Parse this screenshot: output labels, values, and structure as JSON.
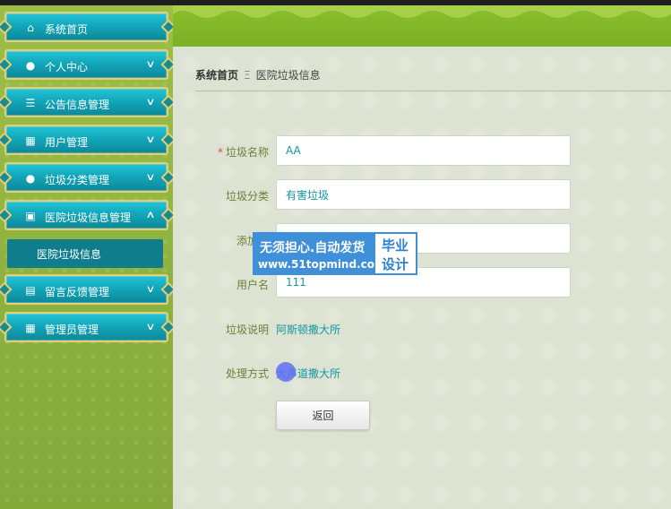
{
  "sidebar": {
    "items": [
      {
        "label": "系统首页",
        "icon": "home-icon",
        "glyph": "⌂",
        "chevron": ""
      },
      {
        "label": "个人中心",
        "icon": "user-icon",
        "glyph": "●",
        "chevron": "∨"
      },
      {
        "label": "公告信息管理",
        "icon": "list-icon",
        "glyph": "☰",
        "chevron": "∨"
      },
      {
        "label": "用户管理",
        "icon": "grid-icon",
        "glyph": "▦",
        "chevron": "∨"
      },
      {
        "label": "垃圾分类管理",
        "icon": "bulb-icon",
        "glyph": "●",
        "chevron": "∨"
      },
      {
        "label": "医院垃圾信息管理",
        "icon": "clipboard-icon",
        "glyph": "▣",
        "chevron": "∧"
      },
      {
        "label": "留言反馈管理",
        "icon": "chart-icon",
        "glyph": "▤",
        "chevron": "∨"
      },
      {
        "label": "管理员管理",
        "icon": "grid-icon",
        "glyph": "▦",
        "chevron": "∨"
      }
    ],
    "submenu": {
      "label": "医院垃圾信息"
    }
  },
  "breadcrumb": {
    "home": "系统首页",
    "separator": "Ξ",
    "current": "医院垃圾信息"
  },
  "form": {
    "name": {
      "label": "垃圾名称",
      "required_mark": "*",
      "value": "AA"
    },
    "category": {
      "label": "垃圾分类",
      "value": "有害垃圾"
    },
    "added": {
      "label": "添加日",
      "value": ""
    },
    "username": {
      "label": "用户名",
      "value": "111"
    },
    "description": {
      "label": "垃圾说明",
      "value": "阿斯顿撒大所"
    },
    "method": {
      "label": "处理方式",
      "value": "大声道撒大所"
    },
    "back_label": "返回"
  },
  "watermark": {
    "line1": "无须担心.自动发货",
    "line2": "www.51topmind.com",
    "right1": "毕业",
    "right2": "设计"
  },
  "colors": {
    "menu_teal": "#12a7bb",
    "menu_border": "#e4cf74",
    "header_green": "#8cbf2c",
    "value_teal": "#1596a3",
    "label_olive": "#6d7f3a"
  }
}
